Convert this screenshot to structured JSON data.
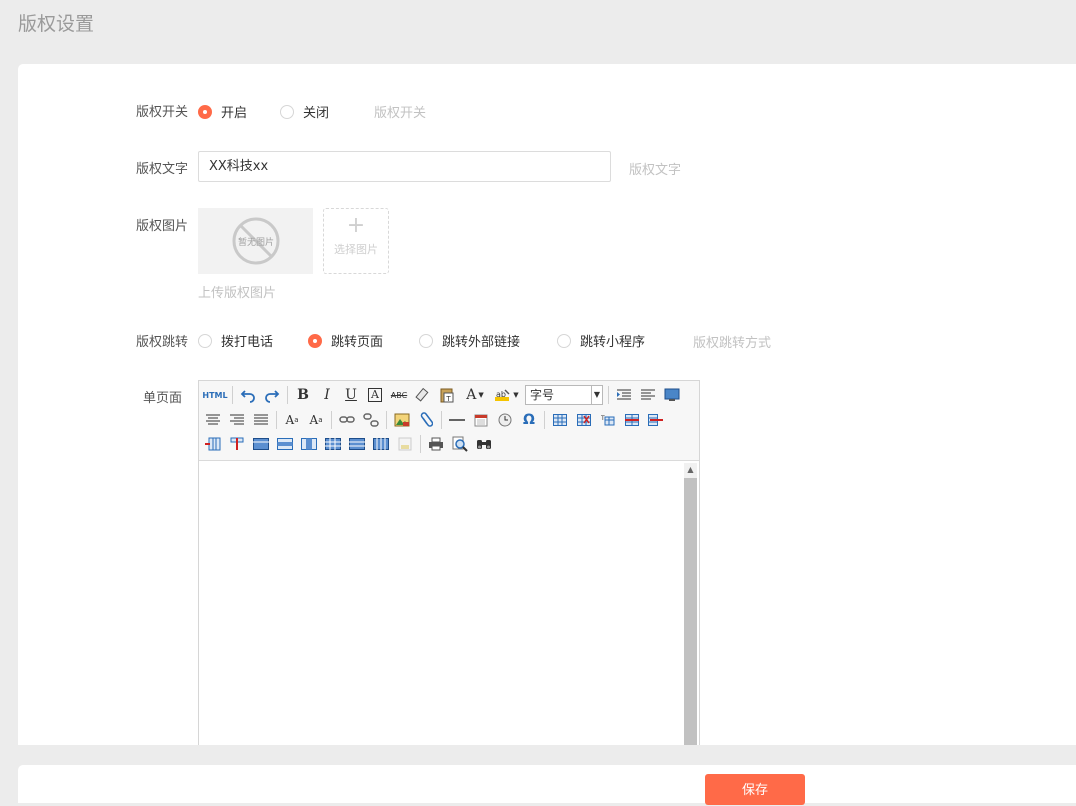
{
  "page": {
    "title": "版权设置"
  },
  "form": {
    "switch": {
      "label": "版权开关",
      "options": [
        {
          "label": "开启",
          "checked": true
        },
        {
          "label": "关闭",
          "checked": false
        }
      ],
      "hint": "版权开关"
    },
    "text": {
      "label": "版权文字",
      "value": "XX科技xx",
      "hint": "版权文字"
    },
    "image": {
      "label": "版权图片",
      "placeholder_text": "暂无图片",
      "pick_text": "选择图片",
      "hint": "上传版权图片"
    },
    "jump": {
      "label": "版权跳转",
      "options": [
        {
          "label": "拨打电话",
          "checked": false
        },
        {
          "label": "跳转页面",
          "checked": true
        },
        {
          "label": "跳转外部链接",
          "checked": false
        },
        {
          "label": "跳转小程序",
          "checked": false
        }
      ],
      "hint": "版权跳转方式"
    },
    "single_page": {
      "label": "单页面",
      "toolbar": {
        "html_label": "HTML",
        "font_size_select": "字号",
        "bold": "B",
        "italic": "I",
        "underline": "U",
        "boxed_a": "A",
        "strike": "ABC",
        "font_color": "A",
        "omega": "Ω"
      }
    }
  },
  "footer": {
    "save_label": "保存"
  },
  "colors": {
    "accent": "#ff6a48",
    "background": "#ececec",
    "hint": "#c2c2c2"
  }
}
